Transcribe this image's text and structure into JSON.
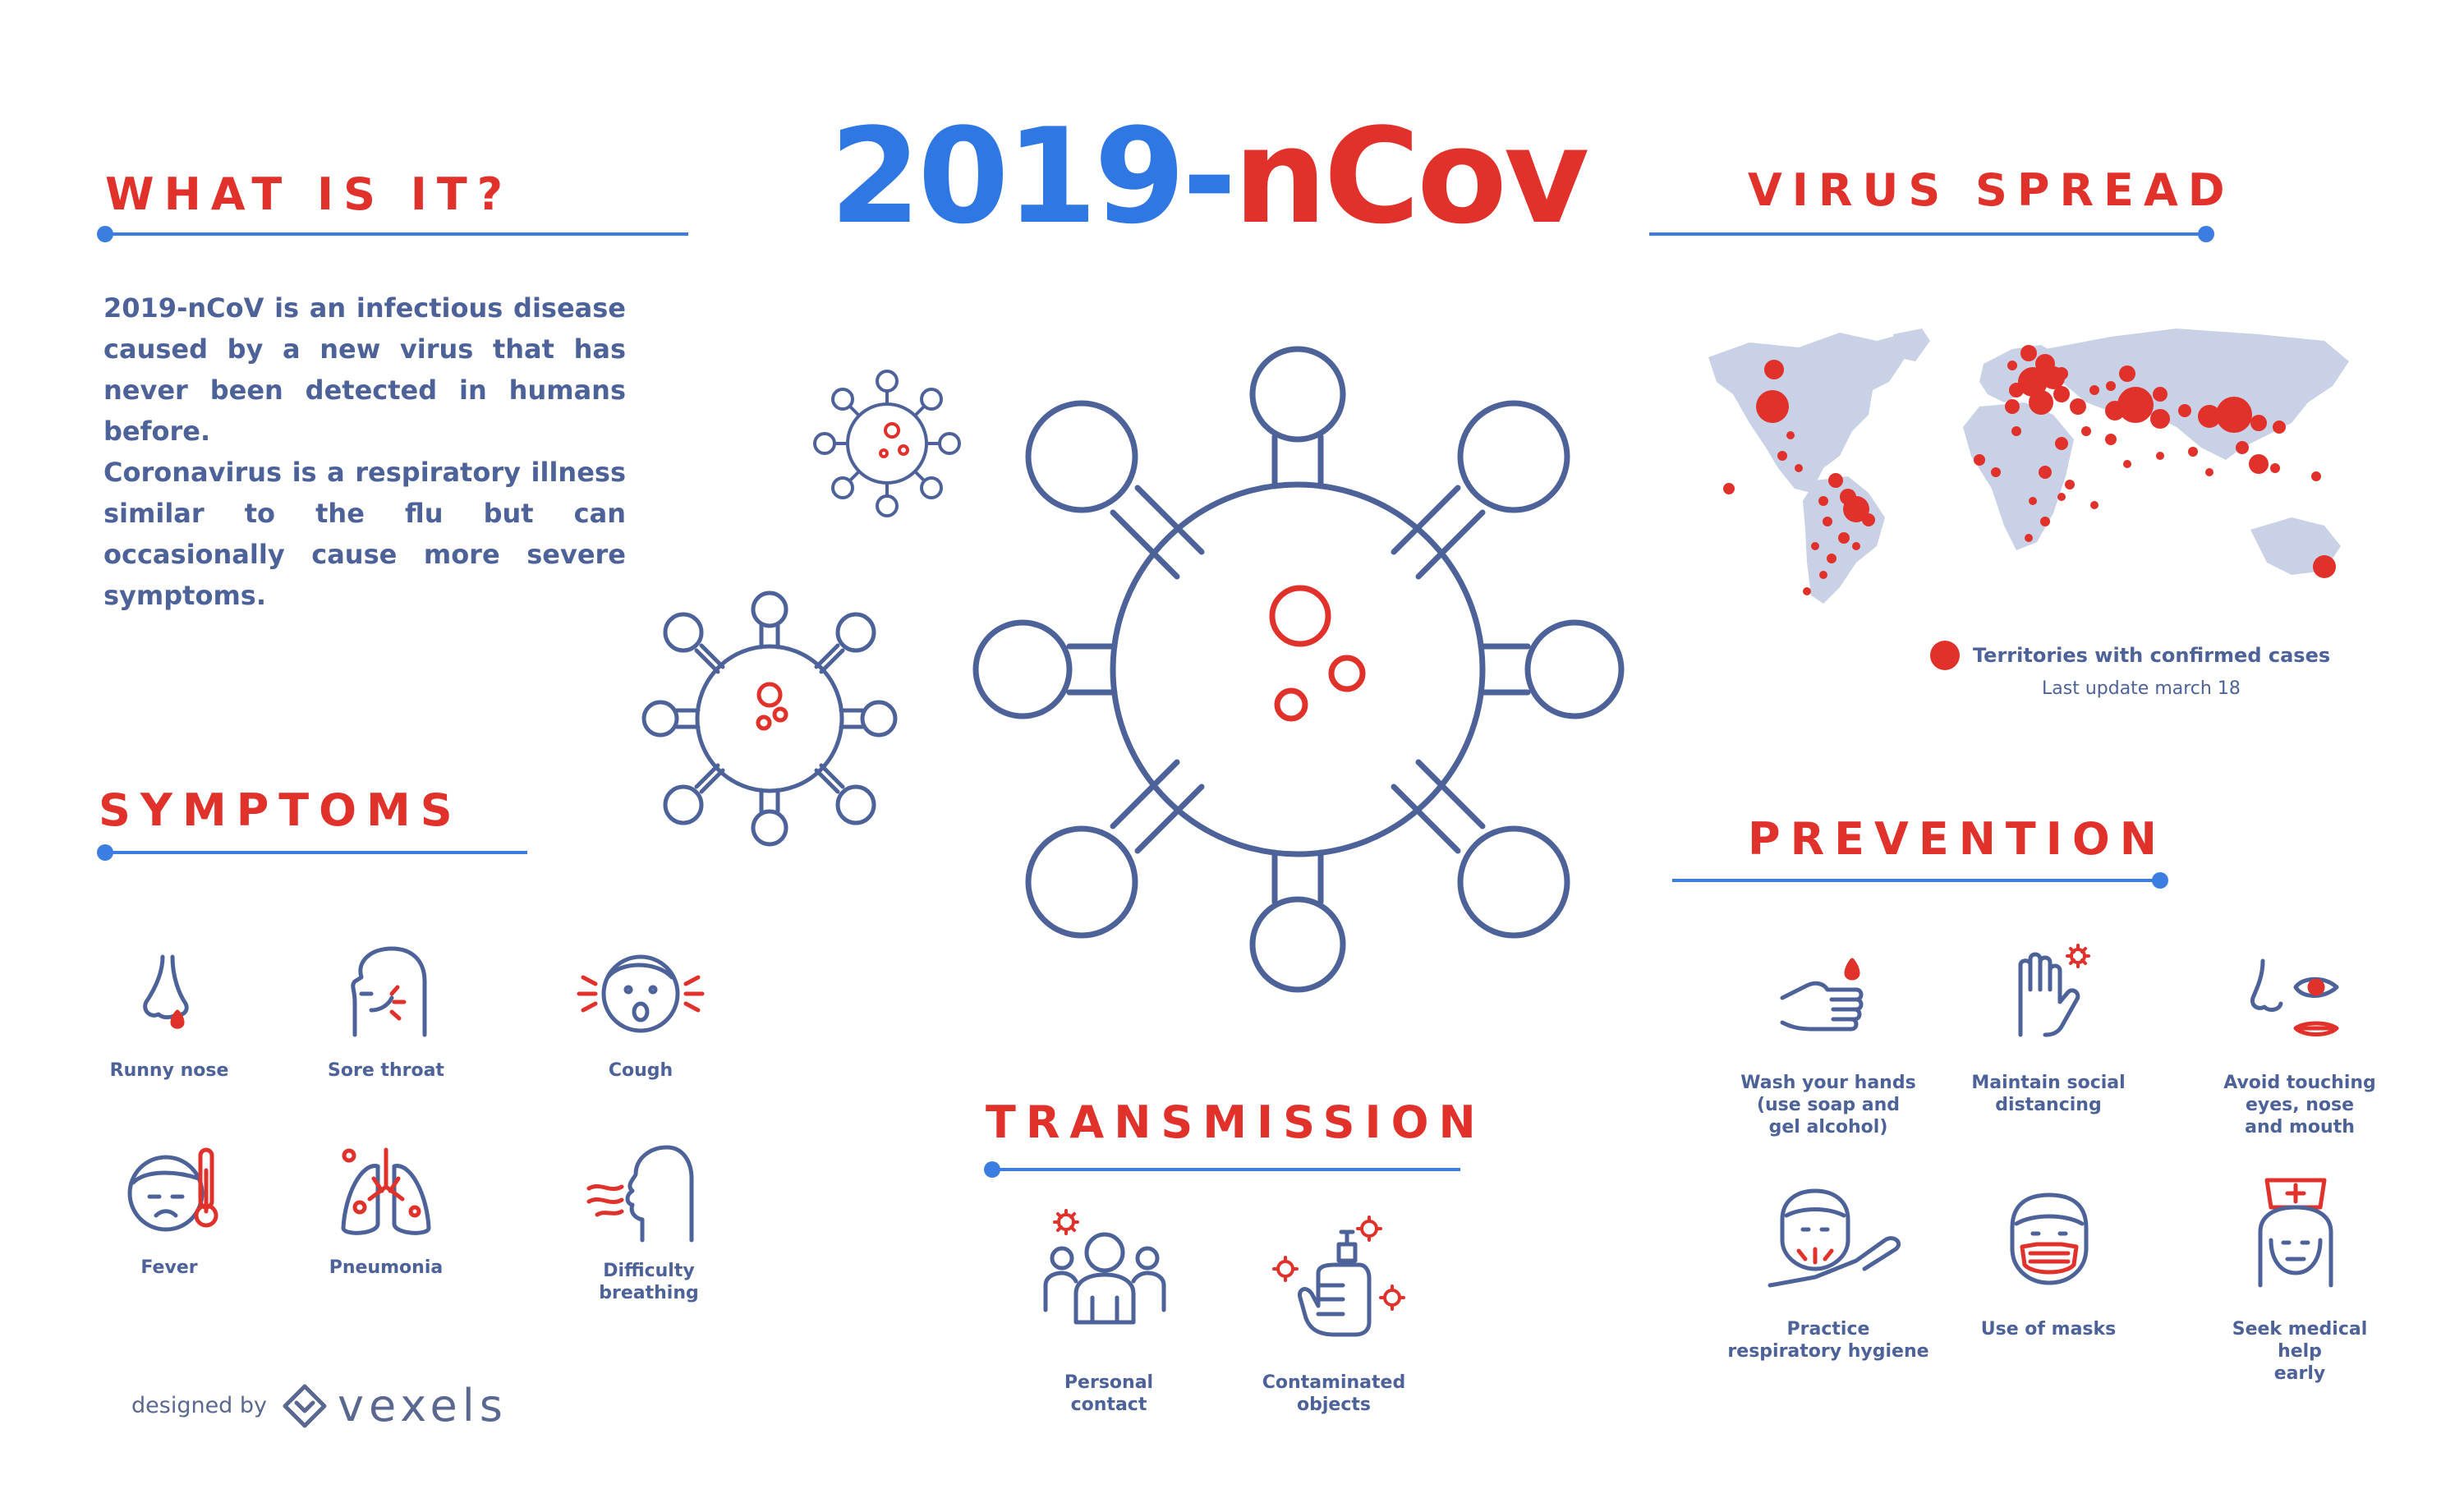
{
  "title": {
    "part1": "2019-",
    "part2": "nCov"
  },
  "what_is_it": {
    "heading": "WHAT IS IT?",
    "para1": "2019-nCoV is an infectious disease caused by a new virus that has never been detected in humans before.",
    "para2": "Coronavirus is a respiratory illness similar to the flu but can occasionally cause more severe symptoms."
  },
  "virus_spread": {
    "heading": "VIRUS SPREAD",
    "legend": "Territories with confirmed cases",
    "update": "Last update march 18"
  },
  "symptoms": {
    "heading": "SYMPTOMS",
    "items": [
      {
        "label": "Runny nose",
        "icon": "runny-nose-icon"
      },
      {
        "label": "Sore throat",
        "icon": "sore-throat-icon"
      },
      {
        "label": "Cough",
        "icon": "cough-icon"
      },
      {
        "label": "Fever",
        "icon": "fever-icon"
      },
      {
        "label": "Pneumonia",
        "icon": "pneumonia-icon"
      },
      {
        "label": "Difficulty\nbreathing",
        "icon": "difficulty-breathing-icon"
      }
    ]
  },
  "transmission": {
    "heading": "TRANSMISSION",
    "items": [
      {
        "label": "Personal\ncontact",
        "icon": "personal-contact-icon"
      },
      {
        "label": "Contaminated\nobjects",
        "icon": "contaminated-objects-icon"
      }
    ]
  },
  "prevention": {
    "heading": "PREVENTION",
    "items": [
      {
        "label": "Wash your hands\n(use soap and\ngel alcohol)",
        "icon": "wash-hands-icon"
      },
      {
        "label": "Maintain social\ndistancing",
        "icon": "social-distancing-icon"
      },
      {
        "label": "Avoid touching\neyes, nose\nand mouth",
        "icon": "avoid-touching-face-icon"
      },
      {
        "label": "Practice\nrespiratory hygiene",
        "icon": "respiratory-hygiene-icon"
      },
      {
        "label": "Use of masks",
        "icon": "mask-icon"
      },
      {
        "label": "Seek medical help\nearly",
        "icon": "medical-help-icon"
      }
    ]
  },
  "credit": {
    "prefix": "designed by",
    "brand": "vexels"
  },
  "colors": {
    "blue": "#3b7de0",
    "red": "#e0312b",
    "navy": "#4d6298",
    "map": "#c9d1e6"
  }
}
